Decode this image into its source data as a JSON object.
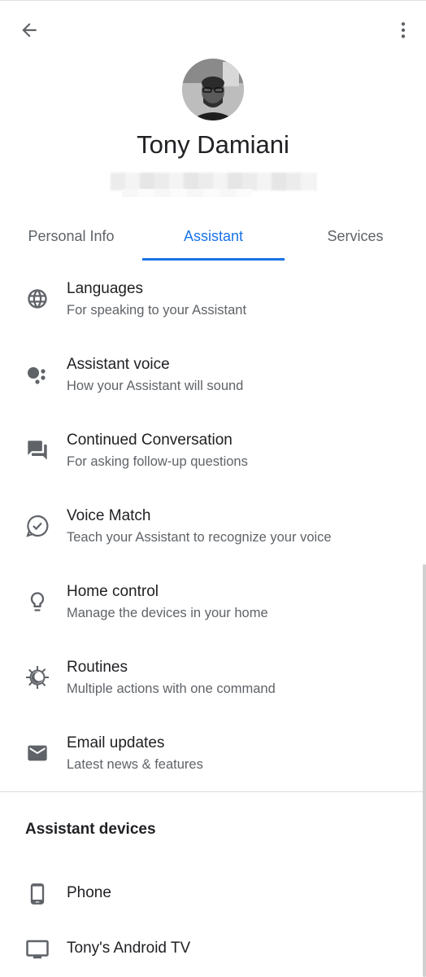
{
  "header": {
    "back_icon": "arrow-back-icon",
    "more_icon": "more-vert-icon"
  },
  "profile": {
    "name": "Tony Damiani",
    "email_blurred": ""
  },
  "tabs": [
    {
      "label": "Personal Info",
      "selected": false
    },
    {
      "label": "Assistant",
      "selected": true
    },
    {
      "label": "Services",
      "selected": false
    }
  ],
  "colors": {
    "accent": "#1a73e8",
    "text_primary": "#202124",
    "text_secondary": "#5f6368",
    "icon": "#5f6368"
  },
  "settings": [
    {
      "icon": "globe-icon",
      "title": "Languages",
      "subtitle": "For speaking to your Assistant"
    },
    {
      "icon": "assistant-dots-icon",
      "title": "Assistant voice",
      "subtitle": "How your Assistant will sound"
    },
    {
      "icon": "chat-bubbles-icon",
      "title": "Continued Conversation",
      "subtitle": "For asking follow-up questions"
    },
    {
      "icon": "voice-match-icon",
      "title": "Voice Match",
      "subtitle": "Teach your Assistant to recognize your voice"
    },
    {
      "icon": "lightbulb-icon",
      "title": "Home control",
      "subtitle": "Manage the devices in your home"
    },
    {
      "icon": "routines-icon",
      "title": "Routines",
      "subtitle": "Multiple actions with one command"
    },
    {
      "icon": "email-icon",
      "title": "Email updates",
      "subtitle": "Latest news & features"
    }
  ],
  "devices_section": {
    "title": "Assistant devices",
    "items": [
      {
        "icon": "phone-icon",
        "label": "Phone"
      },
      {
        "icon": "tv-icon",
        "label": "Tony's Android TV"
      }
    ]
  }
}
